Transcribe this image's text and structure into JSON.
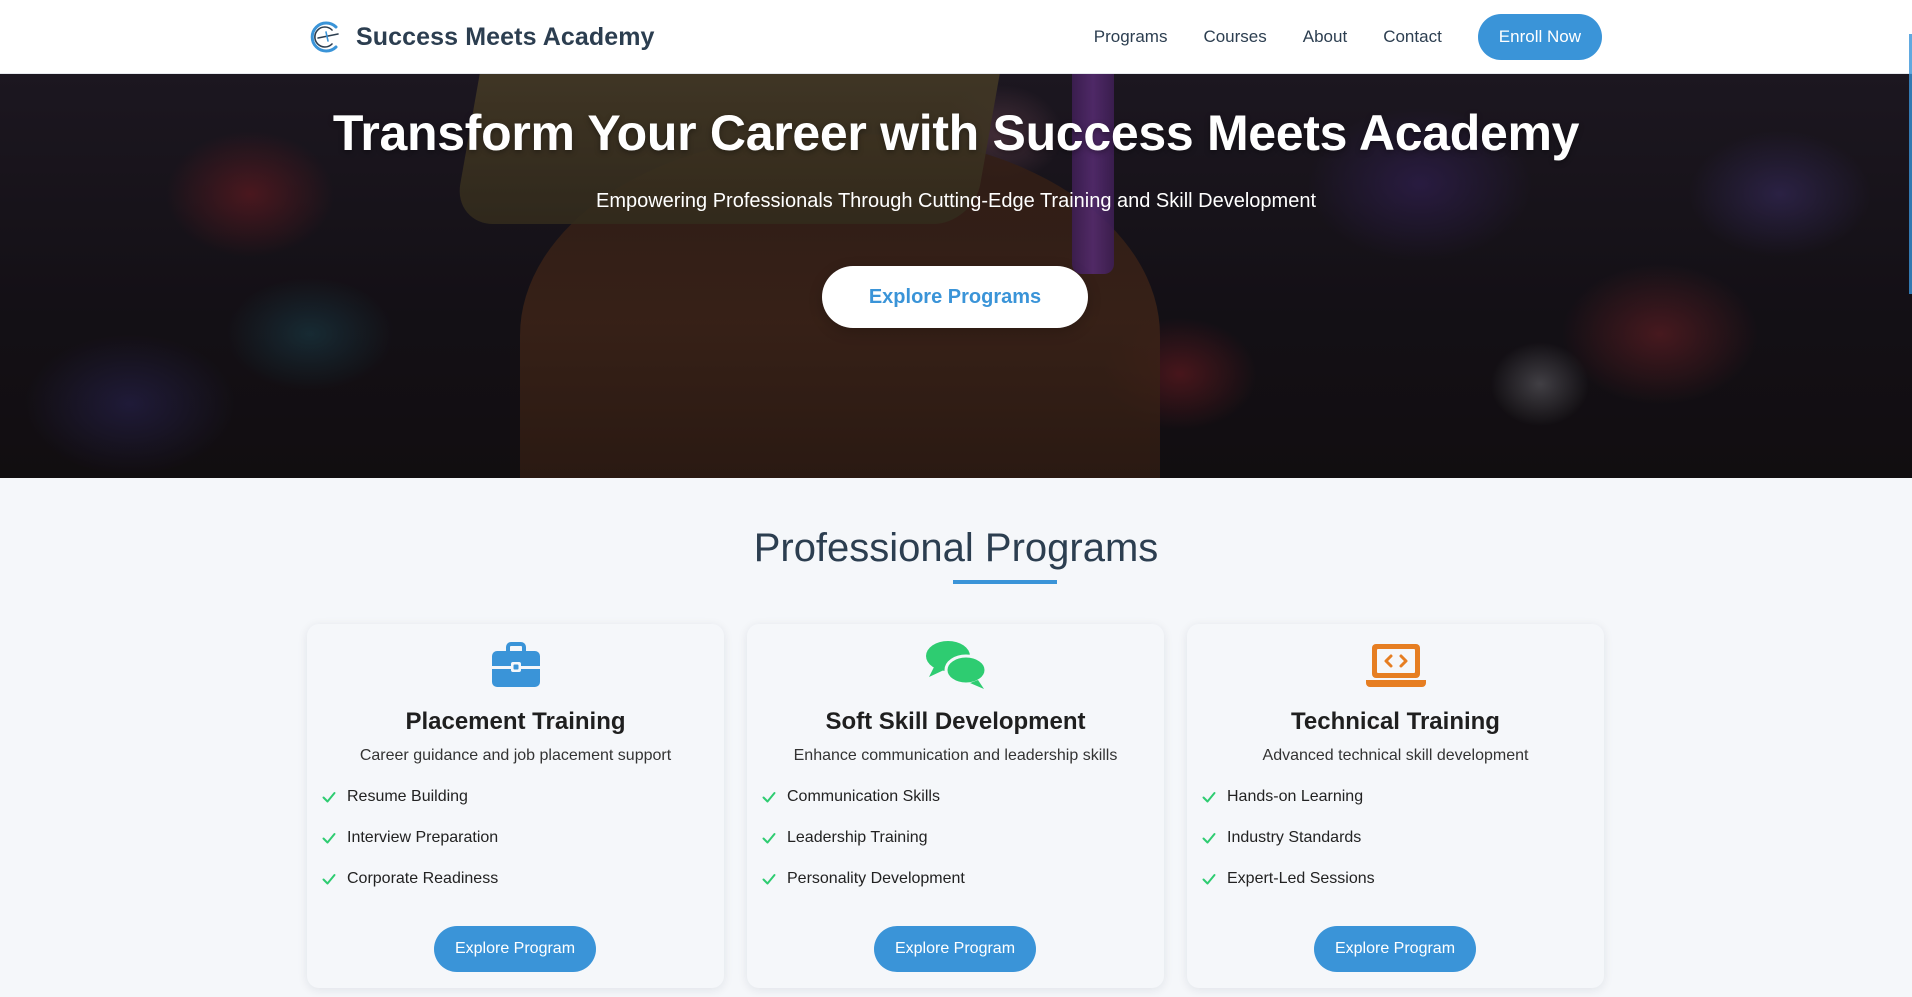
{
  "navbar": {
    "brand": "Success Meets Academy",
    "logo_icon": "academy-logo-icon",
    "links": [
      "Programs",
      "Courses",
      "About",
      "Contact"
    ],
    "enroll_label": "Enroll Now"
  },
  "hero": {
    "title": "Transform Your Career with Success Meets Academy",
    "subtitle": "Empowering Professionals Through Cutting-Edge Training and Skill Development",
    "cta_label": "Explore Programs"
  },
  "programs": {
    "title": "Professional Programs",
    "cards": [
      {
        "icon": "briefcase-icon",
        "icon_color": "#3a94d8",
        "title": "Placement Training",
        "description": "Career guidance and job placement support",
        "features": [
          "Resume Building",
          "Interview Preparation",
          "Corporate Readiness"
        ],
        "button_label": "Explore Program"
      },
      {
        "icon": "chat-bubbles-icon",
        "icon_color": "#2ecc71",
        "title": "Soft Skill Development",
        "description": "Enhance communication and leadership skills",
        "features": [
          "Communication Skills",
          "Leadership Training",
          "Personality Development"
        ],
        "button_label": "Explore Program"
      },
      {
        "icon": "laptop-code-icon",
        "icon_color": "#e67e22",
        "title": "Technical Training",
        "description": "Advanced technical skill development",
        "features": [
          "Hands-on Learning",
          "Industry Standards",
          "Expert-Led Sessions"
        ],
        "button_label": "Explore Program"
      }
    ]
  },
  "colors": {
    "accent": "#3a94d8",
    "check": "#2ecc71",
    "heading": "#2c3e50"
  }
}
